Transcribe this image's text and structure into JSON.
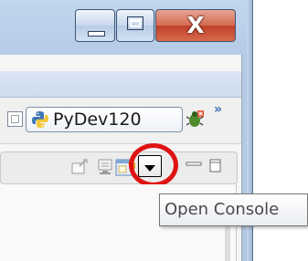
{
  "window": {
    "caption_buttons": [
      {
        "name": "minimize",
        "icon": "minimize-icon"
      },
      {
        "name": "maximize",
        "icon": "maximize-icon"
      },
      {
        "name": "close",
        "icon": "close-icon",
        "glyph": "X"
      }
    ]
  },
  "perspective": {
    "open_icon": "open-perspective-icon",
    "active_label": "PyDev120",
    "active_icon": "python-icon",
    "other_icon": "debug-perspective-icon",
    "overflow_glyph": "»"
  },
  "view_toolbar": {
    "icons": [
      "pin-console-icon",
      "display-console-icon",
      "open-console-icon",
      "dropdown-arrow-icon",
      "minimize-view-icon",
      "maximize-view-icon"
    ],
    "highlight_color": "#e01313"
  },
  "tooltip": {
    "text": "Open Console"
  }
}
